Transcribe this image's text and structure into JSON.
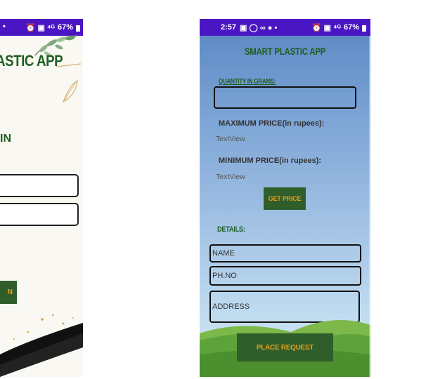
{
  "left_phone": {
    "statusbar": {
      "dot": "•",
      "icons": "⏰ ▣ ⁴ᴳ",
      "battery": "67%"
    },
    "title": "ASTIC APP",
    "subhead": "IN",
    "button_label": "N"
  },
  "right_phone": {
    "statusbar": {
      "time": "2:57",
      "left_icons": "▣ ◯ ∞ ● •",
      "right_icons": "⏰ ▣ ⁴ᴳ",
      "battery": "67%"
    },
    "app_title": "SMART PLASTIC APP",
    "quantity_label": "QUANTITY IN GRAMS:",
    "quantity_value": "",
    "max_price_label": "MAXIMUM PRICE(in rupees):",
    "max_price_value": "TextView",
    "min_price_label": "MINIMUM PRICE(in rupees):",
    "min_price_value": "TextView",
    "get_price_button": "GET PRICE",
    "details_label": "DETAILS:",
    "name_placeholder": "NAME",
    "phone_placeholder": "PH.NO",
    "address_placeholder": "ADDRESS",
    "place_request_button": "PLACE REQUEST"
  },
  "colors": {
    "statusbar": "#4a16c4",
    "title_green": "#1e5e22",
    "button_bg": "#2f5e2a",
    "button_text": "#e5a020"
  }
}
